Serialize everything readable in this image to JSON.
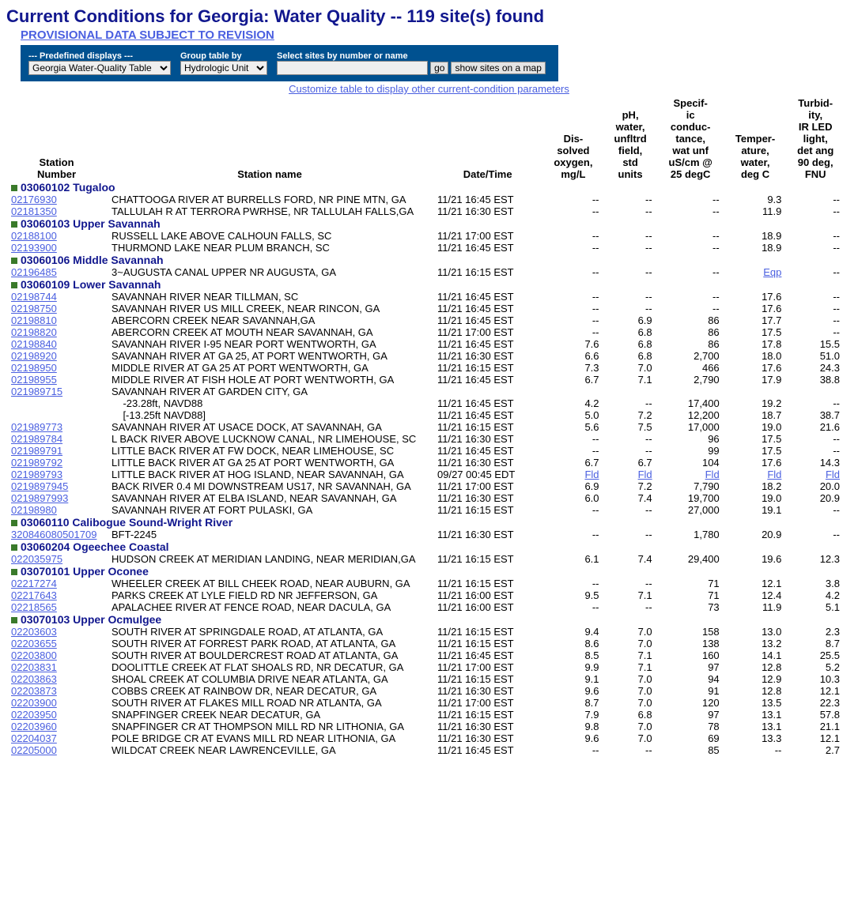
{
  "title": "Current Conditions for Georgia: Water Quality -- 119 site(s) found",
  "prov": "PROVISIONAL DATA SUBJECT TO REVISION",
  "controls": {
    "predef_label": "--- Predefined displays ---",
    "predef_value": "Georgia Water-Quality Table",
    "group_label": "Group table by",
    "group_value": "Hydrologic Unit",
    "select_label": "Select sites by number or name",
    "go": "go",
    "map": "show sites on a map"
  },
  "custlink": "Customize table to display other current-condition parameters",
  "headers": [
    "Station\nNumber",
    "Station name",
    "Date/Time",
    "Dis-\nsolved\noxygen,\nmg/L",
    "pH,\nwater,\nunfltrd\nfield,\nstd\nunits",
    "Specif-\nic\nconduc-\ntance,\nwat unf\nuS/cm @\n25 degC",
    "Temper-\nature,\nwater,\ndeg C",
    "Turbid-\nity,\nIR LED\nlight,\ndet ang\n90 deg,\nFNU"
  ],
  "groups": [
    {
      "code": "03060102",
      "name": "Tugaloo",
      "rows": [
        {
          "id": "02176930",
          "nm": "CHATTOOGA RIVER AT BURRELLS FORD, NR PINE MTN, GA",
          "dt": "11/21 16:45 EST",
          "v": [
            "--",
            "--",
            "--",
            "9.3",
            "--"
          ]
        },
        {
          "id": "02181350",
          "nm": "TALLULAH R AT TERRORA PWRHSE, NR TALLULAH FALLS,GA",
          "dt": "11/21 16:30 EST",
          "v": [
            "--",
            "--",
            "--",
            "11.9",
            "--"
          ]
        }
      ]
    },
    {
      "code": "03060103",
      "name": "Upper Savannah",
      "rows": [
        {
          "id": "02188100",
          "nm": "RUSSELL LAKE ABOVE CALHOUN FALLS, SC",
          "dt": "11/21 17:00 EST",
          "v": [
            "--",
            "--",
            "--",
            "18.9",
            "--"
          ]
        },
        {
          "id": "02193900",
          "nm": "THURMOND LAKE NEAR PLUM BRANCH, SC",
          "dt": "11/21 16:45 EST",
          "v": [
            "--",
            "--",
            "--",
            "18.9",
            "--"
          ]
        }
      ]
    },
    {
      "code": "03060106",
      "name": "Middle Savannah",
      "rows": [
        {
          "id": "02196485",
          "nm": "3~AUGUSTA CANAL UPPER NR AUGUSTA, GA",
          "dt": "11/21 16:15 EST",
          "v": [
            "--",
            "--",
            "--",
            "Eqp",
            "--"
          ],
          "lk": [
            0,
            0,
            0,
            1,
            0
          ]
        }
      ]
    },
    {
      "code": "03060109",
      "name": "Lower Savannah",
      "rows": [
        {
          "id": "02198744",
          "nm": "SAVANNAH RIVER NEAR TILLMAN, SC",
          "dt": "11/21 16:45 EST",
          "v": [
            "--",
            "--",
            "--",
            "17.6",
            "--"
          ]
        },
        {
          "id": "02198750",
          "nm": "SAVANNAH RIVER US MILL CREEK, NEAR RINCON, GA",
          "dt": "11/21 16:45 EST",
          "v": [
            "--",
            "--",
            "--",
            "17.6",
            "--"
          ]
        },
        {
          "id": "02198810",
          "nm": "ABERCORN CREEK NEAR SAVANNAH,GA",
          "dt": "11/21 16:45 EST",
          "v": [
            "--",
            "6.9",
            "86",
            "17.7",
            "--"
          ]
        },
        {
          "id": "02198820",
          "nm": "ABERCORN CREEK AT MOUTH NEAR SAVANNAH, GA",
          "dt": "11/21 17:00 EST",
          "v": [
            "--",
            "6.8",
            "86",
            "17.5",
            "--"
          ]
        },
        {
          "id": "02198840",
          "nm": "SAVANNAH RIVER I-95 NEAR PORT WENTWORTH, GA",
          "dt": "11/21 16:45 EST",
          "v": [
            "7.6",
            "6.8",
            "86",
            "17.8",
            "15.5"
          ]
        },
        {
          "id": "02198920",
          "nm": "SAVANNAH RIVER AT GA 25, AT PORT WENTWORTH, GA",
          "dt": "11/21 16:30 EST",
          "v": [
            "6.6",
            "6.8",
            "2,700",
            "18.0",
            "51.0"
          ]
        },
        {
          "id": "02198950",
          "nm": "MIDDLE RIVER AT GA 25 AT PORT WENTWORTH, GA",
          "dt": "11/21 16:15 EST",
          "v": [
            "7.3",
            "7.0",
            "466",
            "17.6",
            "24.3"
          ]
        },
        {
          "id": "02198955",
          "nm": "MIDDLE RIVER AT FISH HOLE AT PORT WENTWORTH, GA",
          "dt": "11/21 16:45 EST",
          "v": [
            "6.7",
            "7.1",
            "2,790",
            "17.9",
            "38.8"
          ]
        },
        {
          "id": "021989715",
          "nm": "SAVANNAH RIVER AT GARDEN CITY, GA",
          "dt": "",
          "v": [
            "",
            "",
            "",
            "",
            ""
          ],
          "sub": [
            {
              "nm": "    -23.28ft, NAVD88",
              "dt": "11/21 16:45 EST",
              "v": [
                "4.2",
                "--",
                "17,400",
                "19.2",
                "--"
              ]
            },
            {
              "nm": "    [-13.25ft NAVD88]",
              "dt": "11/21 16:45 EST",
              "v": [
                "5.0",
                "7.2",
                "12,200",
                "18.7",
                "38.7"
              ]
            }
          ]
        },
        {
          "id": "021989773",
          "nm": "SAVANNAH RIVER AT USACE DOCK, AT SAVANNAH, GA",
          "dt": "11/21 16:15 EST",
          "v": [
            "5.6",
            "7.5",
            "17,000",
            "19.0",
            "21.6"
          ]
        },
        {
          "id": "021989784",
          "nm": "L BACK RIVER ABOVE LUCKNOW CANAL, NR LIMEHOUSE, SC",
          "dt": "11/21 16:30 EST",
          "v": [
            "--",
            "--",
            "96",
            "17.5",
            "--"
          ]
        },
        {
          "id": "021989791",
          "nm": "LITTLE BACK RIVER AT FW DOCK, NEAR LIMEHOUSE, SC",
          "dt": "11/21 16:45 EST",
          "v": [
            "--",
            "--",
            "99",
            "17.5",
            "--"
          ]
        },
        {
          "id": "021989792",
          "nm": "LITTLE BACK RIVER AT GA 25 AT PORT WENTWORTH, GA",
          "dt": "11/21 16:30 EST",
          "v": [
            "6.7",
            "6.7",
            "104",
            "17.6",
            "14.3"
          ]
        },
        {
          "id": "021989793",
          "nm": "LITTLE BACK RIVER AT HOG ISLAND, NEAR SAVANNAH, GA",
          "dt": "09/27 00:45 EDT",
          "v": [
            "Fld",
            "Fld",
            "Fld",
            "Fld",
            "Fld"
          ],
          "lk": [
            1,
            1,
            1,
            1,
            1
          ]
        },
        {
          "id": "0219897945",
          "nm": "BACK RIVER 0.4 MI DOWNSTREAM US17, NR SAVANNAH, GA",
          "dt": "11/21 17:00 EST",
          "v": [
            "6.9",
            "7.2",
            "7,790",
            "18.2",
            "20.0"
          ]
        },
        {
          "id": "0219897993",
          "nm": "SAVANNAH RIVER AT ELBA ISLAND, NEAR SAVANNAH, GA",
          "dt": "11/21 16:30 EST",
          "v": [
            "6.0",
            "7.4",
            "19,700",
            "19.0",
            "20.9"
          ]
        },
        {
          "id": "02198980",
          "nm": "SAVANNAH RIVER AT FORT PULASKI, GA",
          "dt": "11/21 16:15 EST",
          "v": [
            "--",
            "--",
            "27,000",
            "19.1",
            "--"
          ]
        }
      ]
    },
    {
      "code": "03060110",
      "name": "Calibogue Sound-Wright River",
      "rows": [
        {
          "id": "320846080501709",
          "nm": "BFT-2245",
          "dt": "11/21 16:30 EST",
          "v": [
            "--",
            "--",
            "1,780",
            "20.9",
            "--"
          ]
        }
      ]
    },
    {
      "code": "03060204",
      "name": "Ogeechee Coastal",
      "rows": [
        {
          "id": "022035975",
          "nm": "HUDSON CREEK AT MERIDIAN LANDING, NEAR MERIDIAN,GA",
          "dt": "11/21 16:15 EST",
          "v": [
            "6.1",
            "7.4",
            "29,400",
            "19.6",
            "12.3"
          ]
        }
      ]
    },
    {
      "code": "03070101",
      "name": "Upper Oconee",
      "rows": [
        {
          "id": "02217274",
          "nm": "WHEELER CREEK AT BILL CHEEK ROAD, NEAR AUBURN, GA",
          "dt": "11/21 16:15 EST",
          "v": [
            "--",
            "--",
            "71",
            "12.1",
            "3.8"
          ]
        },
        {
          "id": "02217643",
          "nm": "PARKS CREEK AT LYLE FIELD RD NR JEFFERSON, GA",
          "dt": "11/21 16:00 EST",
          "v": [
            "9.5",
            "7.1",
            "71",
            "12.4",
            "4.2"
          ]
        },
        {
          "id": "02218565",
          "nm": "APALACHEE RIVER AT FENCE ROAD, NEAR DACULA, GA",
          "dt": "11/21 16:00 EST",
          "v": [
            "--",
            "--",
            "73",
            "11.9",
            "5.1"
          ]
        }
      ]
    },
    {
      "code": "03070103",
      "name": "Upper Ocmulgee",
      "rows": [
        {
          "id": "02203603",
          "nm": "SOUTH RIVER AT SPRINGDALE ROAD, AT ATLANTA, GA",
          "dt": "11/21 16:15 EST",
          "v": [
            "9.4",
            "7.0",
            "158",
            "13.0",
            "2.3"
          ]
        },
        {
          "id": "02203655",
          "nm": "SOUTH RIVER AT FORREST PARK ROAD, AT ATLANTA, GA",
          "dt": "11/21 16:15 EST",
          "v": [
            "8.6",
            "7.0",
            "138",
            "13.2",
            "8.7"
          ]
        },
        {
          "id": "02203800",
          "nm": "SOUTH RIVER AT BOULDERCREST ROAD AT ATLANTA, GA",
          "dt": "11/21 16:45 EST",
          "v": [
            "8.5",
            "7.1",
            "160",
            "14.1",
            "25.5"
          ]
        },
        {
          "id": "02203831",
          "nm": "DOOLITTLE CREEK AT FLAT SHOALS RD, NR DECATUR, GA",
          "dt": "11/21 17:00 EST",
          "v": [
            "9.9",
            "7.1",
            "97",
            "12.8",
            "5.2"
          ]
        },
        {
          "id": "02203863",
          "nm": "SHOAL CREEK AT COLUMBIA DRIVE NEAR ATLANTA, GA",
          "dt": "11/21 16:15 EST",
          "v": [
            "9.1",
            "7.0",
            "94",
            "12.9",
            "10.3"
          ]
        },
        {
          "id": "02203873",
          "nm": "COBBS CREEK AT RAINBOW DR, NEAR DECATUR, GA",
          "dt": "11/21 16:30 EST",
          "v": [
            "9.6",
            "7.0",
            "91",
            "12.8",
            "12.1"
          ]
        },
        {
          "id": "02203900",
          "nm": "SOUTH RIVER AT FLAKES MILL ROAD NR ATLANTA, GA",
          "dt": "11/21 17:00 EST",
          "v": [
            "8.7",
            "7.0",
            "120",
            "13.5",
            "22.3"
          ]
        },
        {
          "id": "02203950",
          "nm": "SNAPFINGER CREEK NEAR DECATUR, GA",
          "dt": "11/21 16:15 EST",
          "v": [
            "7.9",
            "6.8",
            "97",
            "13.1",
            "57.8"
          ]
        },
        {
          "id": "02203960",
          "nm": "SNAPFINGER CR AT THOMPSON MILL RD NR LITHONIA, GA",
          "dt": "11/21 16:30 EST",
          "v": [
            "9.8",
            "7.0",
            "78",
            "13.1",
            "21.1"
          ]
        },
        {
          "id": "02204037",
          "nm": "POLE BRIDGE CR AT EVANS MILL RD NEAR LITHONIA, GA",
          "dt": "11/21 16:30 EST",
          "v": [
            "9.6",
            "7.0",
            "69",
            "13.3",
            "12.1"
          ]
        },
        {
          "id": "02205000",
          "nm": "WILDCAT CREEK NEAR LAWRENCEVILLE, GA",
          "dt": "11/21 16:45 EST",
          "v": [
            "--",
            "--",
            "85",
            "--",
            "2.7"
          ]
        }
      ]
    }
  ]
}
